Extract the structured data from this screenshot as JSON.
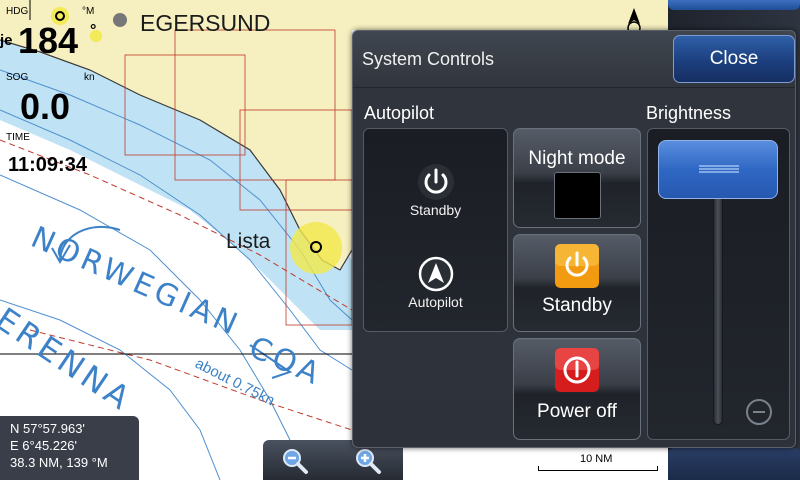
{
  "nav": {
    "hdg_label": "HDG",
    "hdg_unit": "°M",
    "hdg_value": "184",
    "hdg_side": "°",
    "sog_label": "SOG",
    "sog_unit": "kn",
    "sog_value": "0.0",
    "time_label": "TIME",
    "time_value": "11:09:34",
    "partial_left": "je"
  },
  "chart": {
    "place_egersund": "EGERSUND",
    "place_lista": "Lista",
    "sea_norwegian": "NORWEGIAN",
    "sea_coa": "COA",
    "sea_erenna": "ERENNA",
    "current_note": "about 0.75kn",
    "scale_label": "10 NM"
  },
  "position": {
    "lat": "N  57°57.963'",
    "lon": "E   6°45.226'",
    "range_bearing": "38.3 NM, 139 °M"
  },
  "icons": {
    "zoom_out": "zoom-out-icon",
    "zoom_in": "zoom-in-icon",
    "north": "north-arrow-icon"
  },
  "dialog": {
    "title": "System Controls",
    "close_label": "Close",
    "autopilot_heading": "Autopilot",
    "brightness_heading": "Brightness",
    "ap_standby_label": "Standby",
    "ap_autopilot_label": "Autopilot",
    "night_mode_label": "Night mode",
    "standby_label": "Standby",
    "power_off_label": "Power off",
    "brightness_level": 1.0
  },
  "colors": {
    "accent_blue": "#2f68c4",
    "standby_orange": "#f29a10",
    "power_red": "#d61d1d",
    "land": "#f6efbf",
    "water": "#bfe3f5"
  }
}
